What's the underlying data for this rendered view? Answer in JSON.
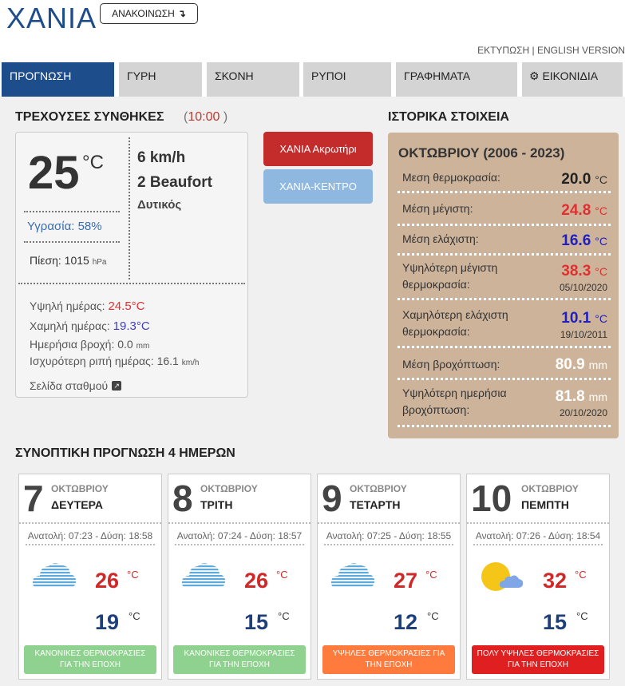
{
  "header": {
    "title": "ΧΑΝΙΑ",
    "announce": "ΑΝΑΚΟΙΝΩΣΗ",
    "print": "ΕΚΤΥΠΩΣΗ",
    "sep": "|",
    "english": "ENGLISH VERSION"
  },
  "tabs": [
    {
      "label": "ΠΡΟΓΝΩΣΗ"
    },
    {
      "label": "ΓΥΡΗ"
    },
    {
      "label": "ΣΚΟΝΗ"
    },
    {
      "label": "ΡΥΠΟΙ"
    },
    {
      "label": "ΓΡΑΦΗΜΑΤΑ"
    },
    {
      "label": "ΕΙΚΟΝΙΔΙΑ"
    }
  ],
  "current": {
    "heading": "ΤΡΕΧΟΥΣΕΣ ΣΥΝΘΗΚΕΣ",
    "time": "10:00",
    "paren_open": "(",
    "paren_close": ")",
    "temp": "25",
    "temp_unit": "°C",
    "humidity": "Υγρασία: 58%",
    "pressure_label": "Πίεση: 1015",
    "pressure_unit": "hPa",
    "wind_speed": "6 km/h",
    "wind_beaufort": "2 Beaufort",
    "wind_dir": "Δυτικός",
    "high_label": "Υψηλή ημέρας:",
    "high_value": "24.5°C",
    "low_label": "Χαμηλή ημέρας:",
    "low_value": "19.3°C",
    "rain_label": "Ημερήσια βροχή: 0.0",
    "rain_unit": "mm",
    "gust_label": "Ισχυρότερη ριπή ημέρας: 16.1",
    "gust_unit": "km/h",
    "station_link": "Σελίδα σταθμού"
  },
  "stations": {
    "btn1": "ΧΑΝΙΑ Ακρωτήρι",
    "btn2": "ΧΑΝΙΑ-ΚΕΝΤΡΟ"
  },
  "history": {
    "heading": "ΙΣΤΟΡΙΚΑ ΣΤΟΙΧΕΙΑ",
    "title": "ΟΚΤΩΒΡΙΟΥ (2006 - 2023)",
    "rows": [
      {
        "label": "Μεση θερμοκρασία:",
        "value": "20.0",
        "unit": "°C",
        "color": "#222222",
        "date": ""
      },
      {
        "label": "Μέση μέγιστη:",
        "value": "24.8",
        "unit": "°C",
        "color": "#e03030",
        "date": ""
      },
      {
        "label": "Μέση ελάχιστη:",
        "value": "16.6",
        "unit": "°C",
        "color": "#2020c0",
        "date": ""
      },
      {
        "label": "Υψηλότερη μέγιστη\nθερμοκρασία:",
        "value": "38.3",
        "unit": "°C",
        "color": "#e03030",
        "date": "05/10/2020"
      },
      {
        "label": "Χαμηλότερη ελάχιστη\nθερμοκρασία:",
        "value": "10.1",
        "unit": "°C",
        "color": "#2020c0",
        "date": "19/10/2011"
      },
      {
        "label": "Μέση βροχόπτωση:",
        "value": "80.9",
        "unit": "mm",
        "color": "#ffffff",
        "date": ""
      },
      {
        "label": "Υψηλότερη ημερήσια\nβροχόπτωση:",
        "value": "81.8",
        "unit": "mm",
        "color": "#ffffff",
        "date": "20/10/2020"
      }
    ]
  },
  "forecast": {
    "heading": "ΣΥΝΟΠΤΙΚΗ ΠΡΟΓΝΩΣΗ 4 ΗΜΕΡΩΝ",
    "days": [
      {
        "num": "7",
        "month": "ΟΚΤΩΒΡΙΟΥ",
        "name": "ΔΕΥΤΕΡΑ",
        "sun": "Ανατολή: 07:23 - Δύση: 18:58",
        "icon": "cloud-icon",
        "max": "26",
        "min": "19",
        "unit": "°C",
        "badge": "ΚΑΝΟΝΙΚΕΣ ΘΕΡΜΟΚΡΑΣΙΕΣ\nΓΙΑ ΤΗΝ ΕΠΟΧΗ",
        "badge_color": "#8fd18f"
      },
      {
        "num": "8",
        "month": "ΟΚΤΩΒΡΙΟΥ",
        "name": "ΤΡΙΤΗ",
        "sun": "Ανατολή: 07:24 - Δύση: 18:57",
        "icon": "cloud-icon",
        "max": "26",
        "min": "15",
        "unit": "°C",
        "badge": "ΚΑΝΟΝΙΚΕΣ ΘΕΡΜΟΚΡΑΣΙΕΣ\nΓΙΑ ΤΗΝ ΕΠΟΧΗ",
        "badge_color": "#8fd18f"
      },
      {
        "num": "9",
        "month": "ΟΚΤΩΒΡΙΟΥ",
        "name": "ΤΕΤΑΡΤΗ",
        "sun": "Ανατολή: 07:25 - Δύση: 18:55",
        "icon": "cloud-icon",
        "max": "27",
        "min": "12",
        "unit": "°C",
        "badge": "ΥΨΗΛΕΣ ΘΕΡΜΟΚΡΑΣΙΕΣ ΓΙΑ\nΤΗΝ ΕΠΟΧΗ",
        "badge_color": "#ff7a3d"
      },
      {
        "num": "10",
        "month": "ΟΚΤΩΒΡΙΟΥ",
        "name": "ΠΕΜΠΤΗ",
        "sun": "Ανατολή: 07:26 - Δύση: 18:54",
        "icon": "sun-cloud-icon",
        "max": "32",
        "min": "15",
        "unit": "°C",
        "badge": "ΠΟΛΥ ΥΨΗΛΕΣ ΘΕΡΜΟΚΡΑΣΙΕΣ\nΓΙΑ ΤΗΝ ΕΠΟΧΗ",
        "badge_color": "#e02020"
      }
    ]
  }
}
